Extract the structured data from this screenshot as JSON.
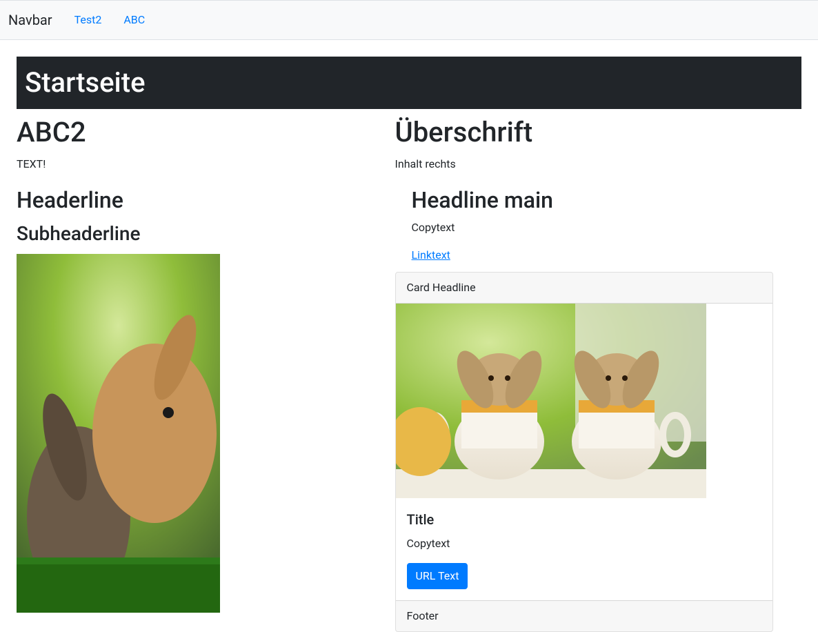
{
  "navbar": {
    "brand": "Navbar",
    "links": [
      {
        "label": "Test2"
      },
      {
        "label": "ABC"
      }
    ]
  },
  "header": {
    "title": "Startseite"
  },
  "leftColumn": {
    "title": "ABC2",
    "text": "TEXT!",
    "headerline": "Headerline",
    "subheaderline": "Subheaderline"
  },
  "rightColumn": {
    "title": "Überschrift",
    "text": "Inhalt rechts",
    "inner": {
      "headline": "Headline main",
      "copytext": "Copytext",
      "linktext": "Linktext"
    }
  },
  "card": {
    "header": "Card Headline",
    "title": "Title",
    "copytext": "Copytext",
    "buttonLabel": "URL Text",
    "footer": "Footer"
  }
}
